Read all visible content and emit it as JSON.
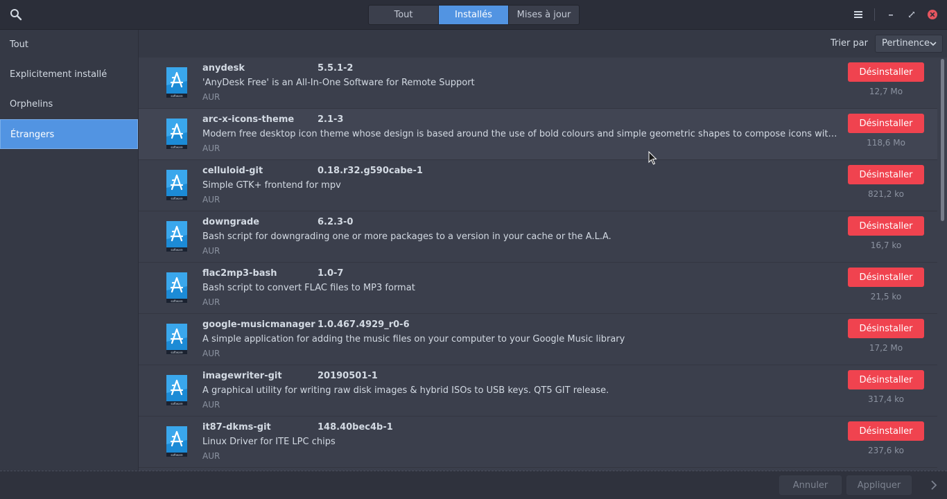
{
  "header": {
    "tabs": [
      {
        "label": "Tout",
        "active": false
      },
      {
        "label": "Installés",
        "active": true
      },
      {
        "label": "Mises à jour",
        "active": false
      }
    ],
    "icons": [
      "search-icon",
      "menu-icon",
      "minimize-icon",
      "maximize-icon",
      "close-icon"
    ]
  },
  "sidebar": {
    "items": [
      {
        "label": "Tout",
        "active": false
      },
      {
        "label": "Explicitement installé",
        "active": false
      },
      {
        "label": "Orphelins",
        "active": false
      },
      {
        "label": "Étrangers",
        "active": true
      }
    ]
  },
  "sort": {
    "label": "Trier par",
    "value": "Pertinence"
  },
  "packages": [
    {
      "name": "anydesk",
      "version": "5.5.1-2",
      "description": "'AnyDesk Free' is an All-In-One Software for Remote Support",
      "repo": "AUR",
      "size": "12,7  Mo",
      "action": "Désinstaller"
    },
    {
      "name": "arc-x-icons-theme",
      "version": "2.1-3",
      "description": "Modern free desktop icon theme whose design is based around the use of bold colours and simple geometric shapes to compose icons with pixel perfect rendering",
      "repo": "AUR",
      "size": "118,6  Mo",
      "action": "Désinstaller"
    },
    {
      "name": "celluloid-git",
      "version": "0.18.r32.g590cabe-1",
      "description": "Simple GTK+ frontend for mpv",
      "repo": "AUR",
      "size": "821,2  ko",
      "action": "Désinstaller"
    },
    {
      "name": "downgrade",
      "version": "6.2.3-0",
      "description": "Bash script for downgrading one or more packages to a version in your cache or the A.L.A.",
      "repo": "AUR",
      "size": "16,7  ko",
      "action": "Désinstaller"
    },
    {
      "name": "flac2mp3-bash",
      "version": "1.0-7",
      "description": "Bash script to convert FLAC files to MP3 format",
      "repo": "AUR",
      "size": "21,5  ko",
      "action": "Désinstaller"
    },
    {
      "name": "google-musicmanager",
      "version": "1.0.467.4929_r0-6",
      "description": "A simple application for adding the music files on your computer to your Google Music library",
      "repo": "AUR",
      "size": "17,2  Mo",
      "action": "Désinstaller"
    },
    {
      "name": "imagewriter-git",
      "version": "20190501-1",
      "description": "A graphical utility for writing raw disk images & hybrid ISOs to USB keys. QT5 GIT release.",
      "repo": "AUR",
      "size": "317,4  ko",
      "action": "Désinstaller"
    },
    {
      "name": "it87-dkms-git",
      "version": "148.40bec4b-1",
      "description": "Linux Driver for ITE LPC chips",
      "repo": "AUR",
      "size": "237,6  ko",
      "action": "Désinstaller"
    }
  ],
  "footer": {
    "cancel_label": "Annuler",
    "apply_label": "Appliquer"
  },
  "colors": {
    "accent": "#5294e2",
    "danger": "#f0434f",
    "background": "#3b3f4c",
    "header": "#2b2e39"
  }
}
